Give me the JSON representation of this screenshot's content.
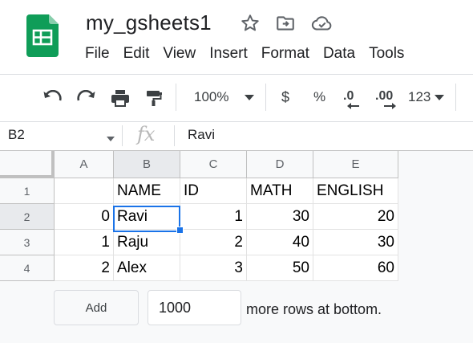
{
  "app": {
    "doc_title": "my_gsheets1",
    "menu": [
      "File",
      "Edit",
      "View",
      "Insert",
      "Format",
      "Data",
      "Tools"
    ]
  },
  "toolbar": {
    "zoom": "100%",
    "currency": "$",
    "percent": "%",
    "decrease_decimal": ".0",
    "increase_decimal": ".00",
    "more_formats": "123"
  },
  "formula_bar": {
    "cell_ref": "B2",
    "fx": "fx",
    "value": "Ravi"
  },
  "sheet": {
    "columns": [
      "A",
      "B",
      "C",
      "D",
      "E"
    ],
    "rows": [
      {
        "num": "1",
        "cells": [
          "",
          "NAME",
          "ID",
          "MATH",
          "ENGLISH"
        ]
      },
      {
        "num": "2",
        "cells": [
          "0",
          "Ravi",
          "1",
          "30",
          "20"
        ]
      },
      {
        "num": "3",
        "cells": [
          "1",
          "Raju",
          "2",
          "40",
          "30"
        ]
      },
      {
        "num": "4",
        "cells": [
          "2",
          "Alex",
          "3",
          "50",
          "60"
        ]
      }
    ],
    "selected_cell": "B2"
  },
  "add_rows": {
    "button_label": "Add",
    "count": "1000",
    "suffix": "more rows at bottom."
  },
  "colors": {
    "selection": "#1a73e8",
    "logo_green": "#0f9d58"
  }
}
